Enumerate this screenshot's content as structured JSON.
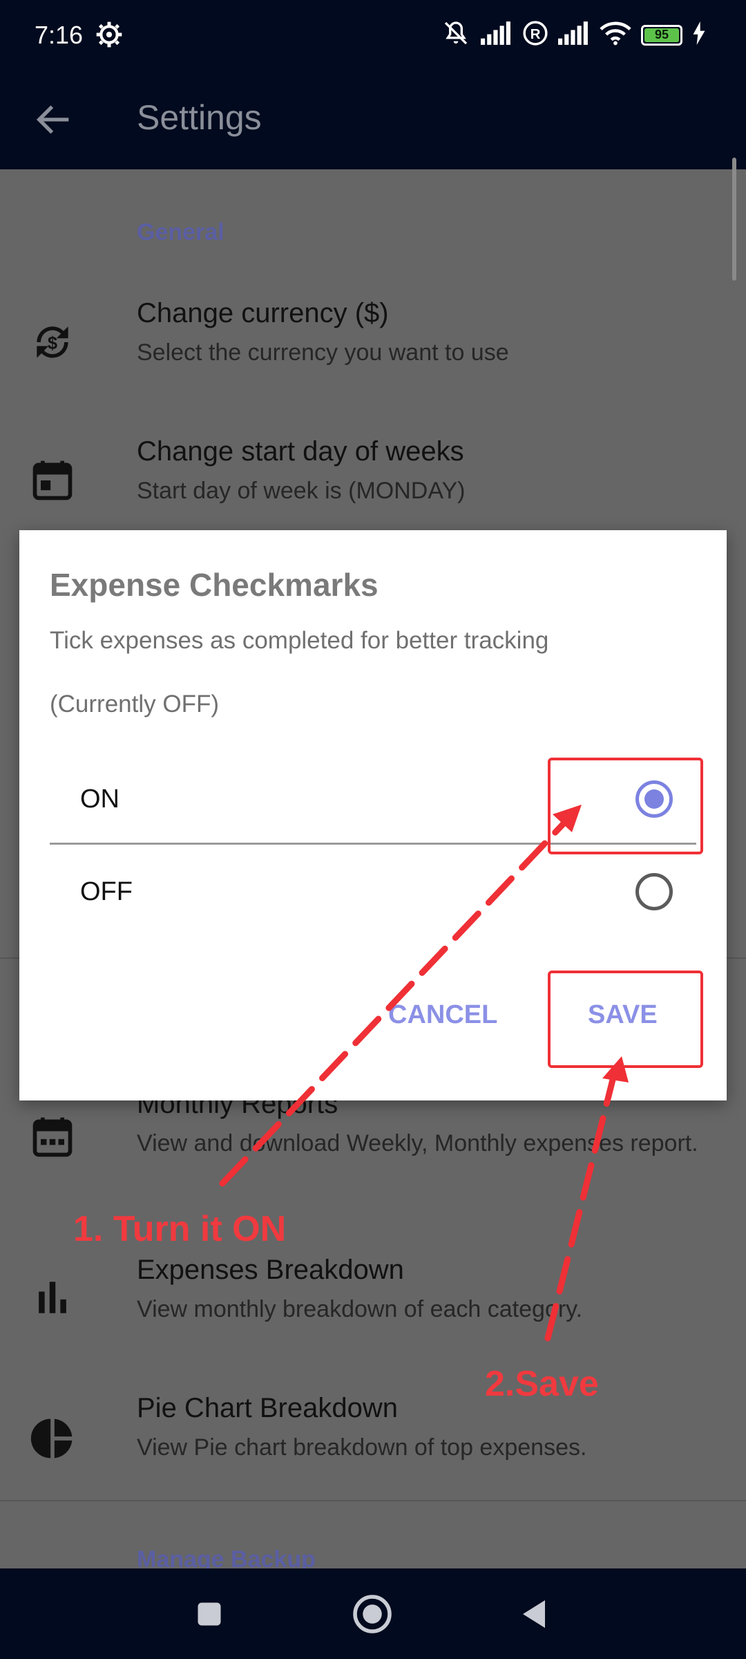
{
  "status_bar": {
    "time": "7:16",
    "battery": "95",
    "icons": [
      "gear-icon",
      "mute-icon",
      "signal-icon",
      "roaming-icon",
      "signal-icon",
      "wifi-icon",
      "battery-icon",
      "charging-icon"
    ]
  },
  "app_bar": {
    "title": "Settings"
  },
  "settings": {
    "general_header": "General",
    "items": [
      {
        "title": "Change currency ($)",
        "subtitle": "Select the currency you want to use",
        "icon": "currency-exchange-icon"
      },
      {
        "title": "Change start day of weeks",
        "subtitle": "Start day of week is (MONDAY)",
        "icon": "calendar-icon"
      },
      {
        "title": "Monthly Reports",
        "subtitle": "View and download Weekly, Monthly expenses report.",
        "icon": "calendar-report-icon"
      },
      {
        "title": "Expenses Breakdown",
        "subtitle": "View monthly breakdown of each category.",
        "icon": "bar-chart-icon"
      },
      {
        "title": "Pie Chart Breakdown",
        "subtitle": "View Pie chart breakdown of top expenses.",
        "icon": "pie-chart-icon"
      }
    ],
    "backup_header": "Manage Backup"
  },
  "dialog": {
    "title": "Expense Checkmarks",
    "message": "Tick expenses as completed for better tracking",
    "current": "(Currently OFF)",
    "options": [
      {
        "label": "ON",
        "selected": true
      },
      {
        "label": "OFF",
        "selected": false
      }
    ],
    "cancel": "CANCEL",
    "save": "SAVE"
  },
  "annotations": {
    "step1": "1. Turn it ON",
    "step2": "2.Save",
    "color": "#ef3036"
  },
  "colors": {
    "accent": "#7b82e0",
    "bar": "#010a1e",
    "scrim": "#666666"
  }
}
